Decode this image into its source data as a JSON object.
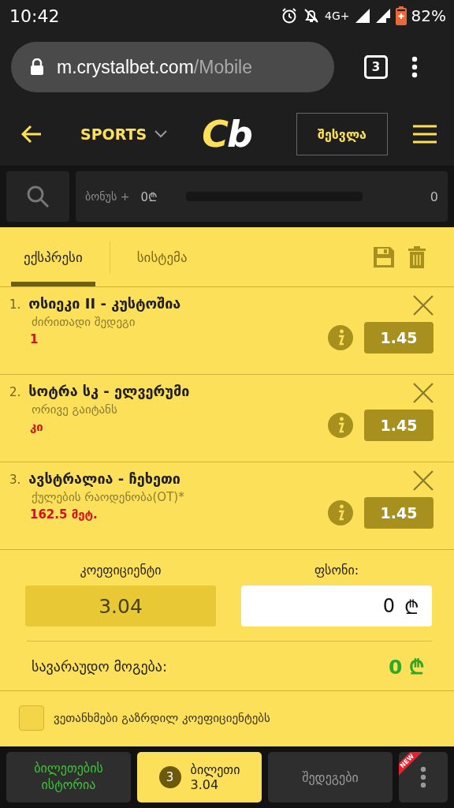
{
  "status_bar": {
    "time": "10:42",
    "network": "4G+",
    "battery": "82%"
  },
  "browser": {
    "url_host": "m.crystalbet.com",
    "url_path": "/Mobile",
    "tab_count": "3"
  },
  "header": {
    "sport_menu": "SPORTS",
    "logo": "Cb",
    "login": "შესვლა"
  },
  "bonus": {
    "label": "ბონუს +",
    "amount": "0₾",
    "level": 0,
    "count": "0"
  },
  "tabs": [
    {
      "label": "ექსპრესი",
      "selected": true
    },
    {
      "label": "სისტემა",
      "selected": false
    }
  ],
  "bets": [
    {
      "number": "1.",
      "match": "ოსიეკი II - კუსტოშია",
      "market": "ძირითადი შედეგი",
      "pick": "1",
      "odds": "1.45"
    },
    {
      "number": "2.",
      "match": "სოტრა სკ - ელვერუმი",
      "market": "ორივე გაიტანს",
      "pick": "კი",
      "odds": "1.45"
    },
    {
      "number": "3.",
      "match": "ავსტრალია - ჩეხეთი",
      "market": "ქულების რაოდენობა(OT)*",
      "pick": "162.5 მეტ.",
      "odds": "1.45"
    }
  ],
  "summary": {
    "coefficient_label": "კოეფიციენტი",
    "coefficient": "3.04",
    "stake_label": "ფსონი:",
    "stake": "0",
    "stake_currency": "₾",
    "win_label": "სავარაუდო მოგება:",
    "win": "0 ₾"
  },
  "accept_higher_odds": {
    "label": "ვეთანხმები გაზრდილ კოეფიციენტებს",
    "checked": false
  },
  "bottom_nav": [
    {
      "kind": "history",
      "label": "ბილეთების ისტორია",
      "selected": false
    },
    {
      "kind": "ticket",
      "label": "ბილეთი",
      "count": "3",
      "value": "3.04",
      "selected": true
    },
    {
      "kind": "results",
      "label": "შედეგები",
      "selected": false
    },
    {
      "kind": "more",
      "badge": "NEW",
      "selected": false
    }
  ]
}
